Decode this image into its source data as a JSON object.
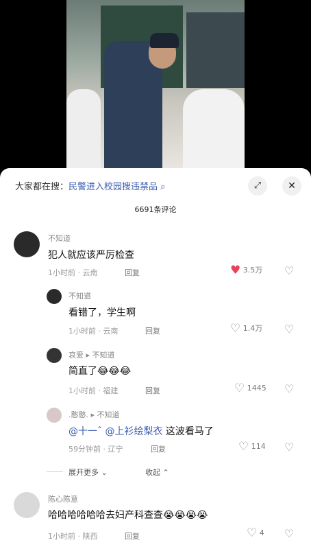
{
  "search": {
    "prefix": "大家都在搜：",
    "query": "民警进入校园搜违禁品",
    "search_icon": "search-icon"
  },
  "header": {
    "expand_icon": "⤢",
    "close_icon": "✕",
    "comment_count": "6691条评论"
  },
  "comments": [
    {
      "user": "不知道",
      "text": "犯人就应该严厉检查",
      "time_loc": "1小时前 · 云南",
      "reply_label": "回复",
      "likes": "3.5万",
      "liked": true
    },
    {
      "user": "不知道",
      "text": "看错了，学生啊",
      "time_loc": "1小时前 · 云南",
      "reply_label": "回复",
      "likes": "1.4万"
    },
    {
      "user": "哀爱",
      "reply_to": "不知道",
      "text": "简直了😂😂😂",
      "time_loc": "1小时前 · 福建",
      "reply_label": "回复",
      "likes": "1445"
    },
    {
      "user": ".憨憨.",
      "reply_to": "不知道",
      "mention1": "@十一ˆ",
      "mention2": "@上衫绘梨衣",
      "text_tail": "这波看马了",
      "time_loc": "59分钟前 · 辽宁",
      "reply_label": "回复",
      "likes": "114"
    },
    {
      "user": "陈心陈意",
      "text": "哈哈哈哈哈哈去妇产科查查😭😭😭😭",
      "time_loc": "1小时前 · 陕西",
      "reply_label": "回复",
      "likes": "4"
    }
  ],
  "thread": {
    "expand_more": "展开更多",
    "collapse": "收起"
  },
  "colors": {
    "accent_link": "#3b5cb0",
    "like_active": "#e8415a"
  }
}
